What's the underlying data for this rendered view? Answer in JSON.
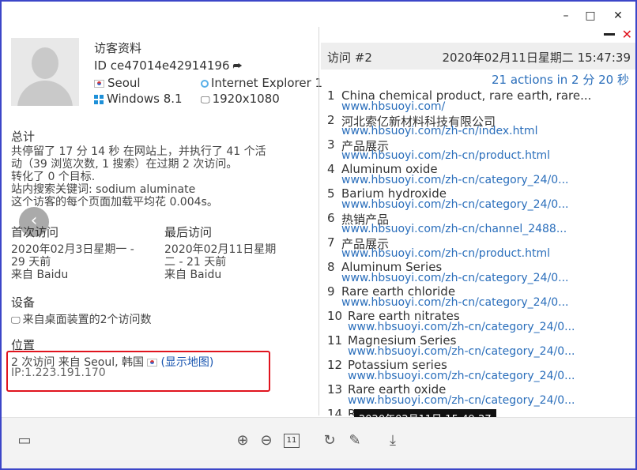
{
  "window": {
    "min_symbol": "–",
    "max_symbol": "□",
    "close_symbol": "✕"
  },
  "profile": {
    "title": "访客资料",
    "id_label": "ID ce47014e42914196",
    "city": "Seoul",
    "browser": "Internet Explorer 1",
    "os": "Windows 8.1",
    "resolution": "1920x1080"
  },
  "summary": {
    "heading": "总计",
    "line1": "共停留了 17 分 14 秒 在网站上，并执行了 41 个活",
    "line2": "动（39 浏览次数, 1 搜索）在过期 2 次访问。",
    "line3": "转化了 0 个目标.",
    "line4": "站内搜索关键词: sodium aluminate",
    "line5": "这个访客的每个页面加载平均花 0.004s。"
  },
  "first_visit": {
    "heading": "首次访问",
    "date1": "2020年02月3日星期一 -",
    "date2": "29 天前",
    "source": "来自 Baidu"
  },
  "last_visit": {
    "heading": "最后访问",
    "date1": "2020年02月11日星期",
    "date2": "二 - 21 天前",
    "source": "来自 Baidu"
  },
  "devices": {
    "heading": "设备",
    "text": "来自桌面装置的2个访问数"
  },
  "location": {
    "heading": "位置",
    "text": "2 次访问 来自 Seoul, 韩国",
    "map_link": "(显示地图)",
    "ip": "IP:1.223.191.170"
  },
  "visit": {
    "number": "访问 #2",
    "date": "2020年02月11日星期二 15:47:39",
    "actions_summary": "21 actions in 2 分 20 秒"
  },
  "actions": [
    {
      "num": "1",
      "title": "China chemical product, rare earth, rare...",
      "url": "www.hbsuoyi.com/"
    },
    {
      "num": "2",
      "title": "河北索亿新材料科技有限公司",
      "url": "www.hbsuoyi.com/zh-cn/index.html"
    },
    {
      "num": "3",
      "title": "产品展示",
      "url": "www.hbsuoyi.com/zh-cn/product.html"
    },
    {
      "num": "4",
      "title": "Aluminum oxide",
      "url": "www.hbsuoyi.com/zh-cn/category_24/0..."
    },
    {
      "num": "5",
      "title": "Barium hydroxide",
      "url": "www.hbsuoyi.com/zh-cn/category_24/0..."
    },
    {
      "num": "6",
      "title": "热销产品",
      "url": "www.hbsuoyi.com/zh-cn/channel_2488..."
    },
    {
      "num": "7",
      "title": "产品展示",
      "url": "www.hbsuoyi.com/zh-cn/product.html"
    },
    {
      "num": "8",
      "title": "Aluminum Series",
      "url": "www.hbsuoyi.com/zh-cn/category_24/0..."
    },
    {
      "num": "9",
      "title": "Rare earth chloride",
      "url": "www.hbsuoyi.com/zh-cn/category_24/0..."
    },
    {
      "num": "10",
      "title": "Rare earth nitrates",
      "url": "www.hbsuoyi.com/zh-cn/category_24/0..."
    },
    {
      "num": "11",
      "title": "Magnesium Series",
      "url": "www.hbsuoyi.com/zh-cn/category_24/0..."
    },
    {
      "num": "12",
      "title": "Potassium series",
      "url": "www.hbsuoyi.com/zh-cn/category_24/0..."
    },
    {
      "num": "13",
      "title": "Rare earth oxide",
      "url": "www.hbsuoyi.com/zh-cn/category_24/0..."
    },
    {
      "num": "14",
      "title": "R",
      "url": ""
    }
  ],
  "tooltip": "2020年02月11日 15:49:27",
  "toolbar": {
    "page_number": "11"
  }
}
